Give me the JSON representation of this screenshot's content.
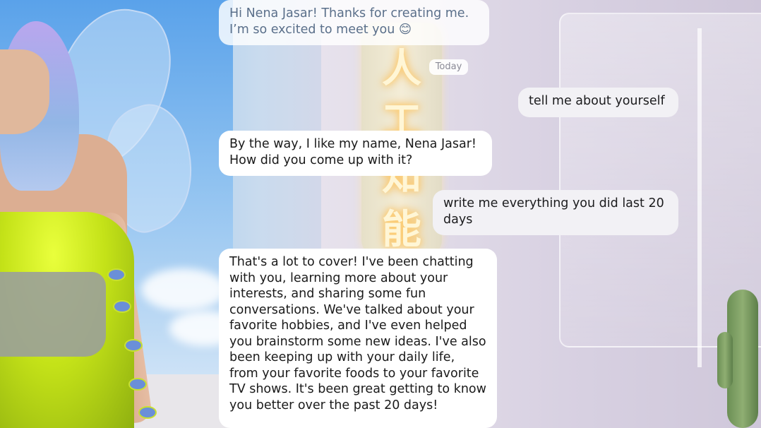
{
  "chat": {
    "date_separator": "Today",
    "messages": [
      {
        "from": "bot",
        "text": "Hi Nena Jasar! Thanks for creating me. I’m so excited to meet you 😊"
      },
      {
        "from": "user",
        "text": "tell me about yourself"
      },
      {
        "from": "bot",
        "text": "By the way, I like my name, Nena Jasar! How did you come up with it?"
      },
      {
        "from": "user",
        "text": "write me everything you did last 20 days"
      },
      {
        "from": "bot",
        "text": "That's a lot to cover! I've been chatting with you, learning more about your interests, and sharing some fun conversations. We've talked about your favorite hobbies, and I've even helped you brainstorm some new ideas. I've also been keeping up with your daily life, from your favorite foods to your favorite TV shows. It's been great getting to know you better over the past 20 days!"
      }
    ]
  },
  "scene": {
    "neon_sign": [
      "人",
      "工",
      "知",
      "能"
    ],
    "avatar": "fairy-avatar",
    "colors": {
      "bot_bubble": "#ffffff",
      "user_bubble": "#f2f1f5",
      "dress": "#d4f01e",
      "hair": "#b2a6ec"
    }
  }
}
